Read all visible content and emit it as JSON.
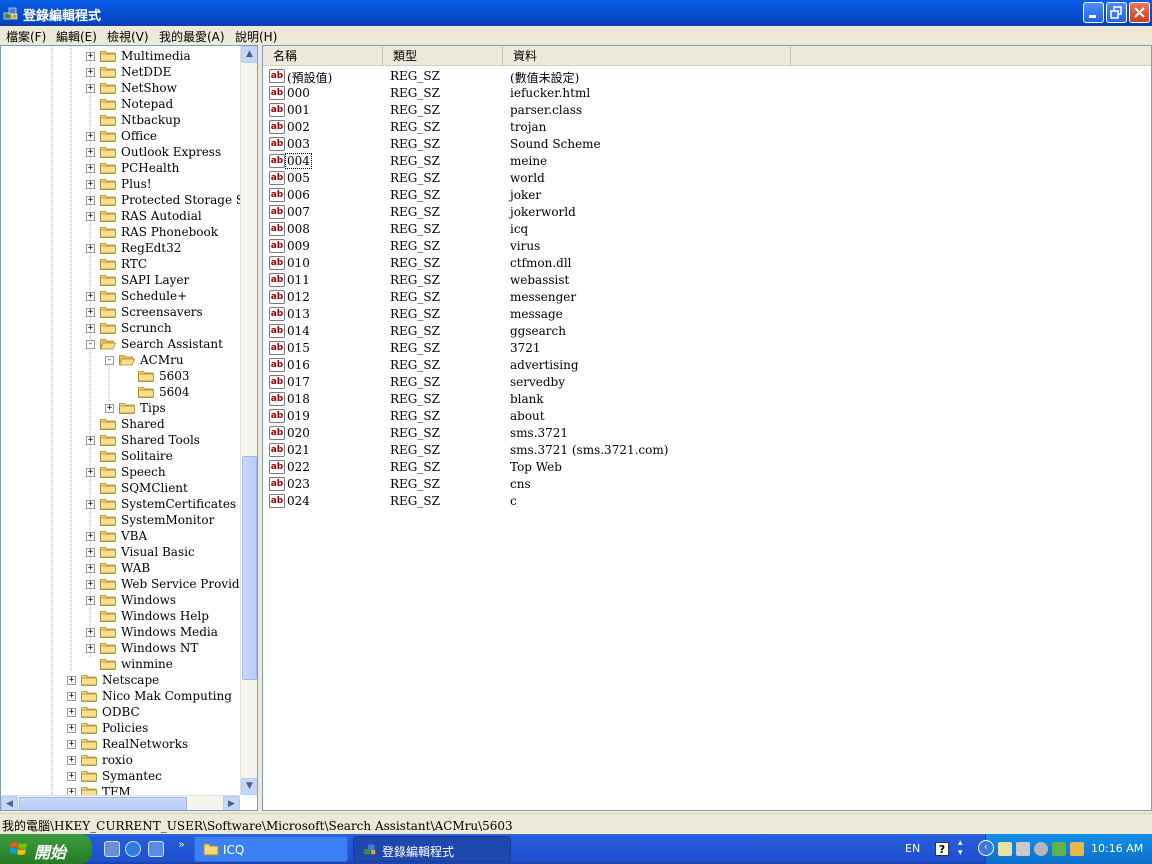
{
  "window": {
    "title": "登錄編輯程式"
  },
  "menu": [
    {
      "label": "檔案(F)"
    },
    {
      "label": "編輯(E)"
    },
    {
      "label": "檢視(V)"
    },
    {
      "label": "我的最愛(A)"
    },
    {
      "label": "說明(H)"
    }
  ],
  "tree": [
    {
      "label": "Multimedia",
      "level": 2,
      "expand": "+"
    },
    {
      "label": "NetDDE",
      "level": 2,
      "expand": "+"
    },
    {
      "label": "NetShow",
      "level": 2,
      "expand": "+"
    },
    {
      "label": "Notepad",
      "level": 2,
      "expand": ""
    },
    {
      "label": "Ntbackup",
      "level": 2,
      "expand": ""
    },
    {
      "label": "Office",
      "level": 2,
      "expand": "+"
    },
    {
      "label": "Outlook Express",
      "level": 2,
      "expand": "+"
    },
    {
      "label": "PCHealth",
      "level": 2,
      "expand": "+"
    },
    {
      "label": "Plus!",
      "level": 2,
      "expand": "+"
    },
    {
      "label": "Protected Storage System",
      "level": 2,
      "expand": "+"
    },
    {
      "label": "RAS Autodial",
      "level": 2,
      "expand": "+"
    },
    {
      "label": "RAS Phonebook",
      "level": 2,
      "expand": ""
    },
    {
      "label": "RegEdt32",
      "level": 2,
      "expand": "+"
    },
    {
      "label": "RTC",
      "level": 2,
      "expand": ""
    },
    {
      "label": "SAPI Layer",
      "level": 2,
      "expand": ""
    },
    {
      "label": "Schedule+",
      "level": 2,
      "expand": "+"
    },
    {
      "label": "Screensavers",
      "level": 2,
      "expand": "+"
    },
    {
      "label": "Scrunch",
      "level": 2,
      "expand": "+"
    },
    {
      "label": "Search Assistant",
      "level": 2,
      "expand": "-"
    },
    {
      "label": "ACMru",
      "level": 3,
      "expand": "-"
    },
    {
      "label": "5603",
      "level": 4,
      "expand": ""
    },
    {
      "label": "5604",
      "level": 4,
      "expand": ""
    },
    {
      "label": "Tips",
      "level": 3,
      "expand": "+"
    },
    {
      "label": "Shared",
      "level": 2,
      "expand": ""
    },
    {
      "label": "Shared Tools",
      "level": 2,
      "expand": "+"
    },
    {
      "label": "Solitaire",
      "level": 2,
      "expand": ""
    },
    {
      "label": "Speech",
      "level": 2,
      "expand": "+"
    },
    {
      "label": "SQMClient",
      "level": 2,
      "expand": ""
    },
    {
      "label": "SystemCertificates",
      "level": 2,
      "expand": "+"
    },
    {
      "label": "SystemMonitor",
      "level": 2,
      "expand": ""
    },
    {
      "label": "VBA",
      "level": 2,
      "expand": "+"
    },
    {
      "label": "Visual Basic",
      "level": 2,
      "expand": "+"
    },
    {
      "label": "WAB",
      "level": 2,
      "expand": "+"
    },
    {
      "label": "Web Service Providers",
      "level": 2,
      "expand": "+"
    },
    {
      "label": "Windows",
      "level": 2,
      "expand": "+"
    },
    {
      "label": "Windows Help",
      "level": 2,
      "expand": ""
    },
    {
      "label": "Windows Media",
      "level": 2,
      "expand": "+"
    },
    {
      "label": "Windows NT",
      "level": 2,
      "expand": "+"
    },
    {
      "label": "winmine",
      "level": 2,
      "expand": ""
    },
    {
      "label": "Netscape",
      "level": 1,
      "expand": "+"
    },
    {
      "label": "Nico Mak Computing",
      "level": 1,
      "expand": "+"
    },
    {
      "label": "ODBC",
      "level": 1,
      "expand": "+"
    },
    {
      "label": "Policies",
      "level": 1,
      "expand": "+"
    },
    {
      "label": "RealNetworks",
      "level": 1,
      "expand": "+"
    },
    {
      "label": "roxio",
      "level": 1,
      "expand": "+"
    },
    {
      "label": "Symantec",
      "level": 1,
      "expand": "+"
    },
    {
      "label": "TFM",
      "level": 1,
      "expand": "+"
    }
  ],
  "list": {
    "columns": [
      "名稱",
      "類型",
      "資料"
    ],
    "rows": [
      {
        "name": "(預設值)",
        "type": "REG_SZ",
        "data": "(數值未設定)"
      },
      {
        "name": "000",
        "type": "REG_SZ",
        "data": "iefucker.html"
      },
      {
        "name": "001",
        "type": "REG_SZ",
        "data": "parser.class"
      },
      {
        "name": "002",
        "type": "REG_SZ",
        "data": "trojan"
      },
      {
        "name": "003",
        "type": "REG_SZ",
        "data": "Sound Scheme"
      },
      {
        "name": "004",
        "type": "REG_SZ",
        "data": "meine"
      },
      {
        "name": "005",
        "type": "REG_SZ",
        "data": "world"
      },
      {
        "name": "006",
        "type": "REG_SZ",
        "data": "joker"
      },
      {
        "name": "007",
        "type": "REG_SZ",
        "data": "jokerworld"
      },
      {
        "name": "008",
        "type": "REG_SZ",
        "data": "icq"
      },
      {
        "name": "009",
        "type": "REG_SZ",
        "data": "virus"
      },
      {
        "name": "010",
        "type": "REG_SZ",
        "data": "ctfmon.dll"
      },
      {
        "name": "011",
        "type": "REG_SZ",
        "data": "webassist"
      },
      {
        "name": "012",
        "type": "REG_SZ",
        "data": "messenger"
      },
      {
        "name": "013",
        "type": "REG_SZ",
        "data": "message"
      },
      {
        "name": "014",
        "type": "REG_SZ",
        "data": "ggsearch"
      },
      {
        "name": "015",
        "type": "REG_SZ",
        "data": "3721"
      },
      {
        "name": "016",
        "type": "REG_SZ",
        "data": "advertising"
      },
      {
        "name": "017",
        "type": "REG_SZ",
        "data": "servedby"
      },
      {
        "name": "018",
        "type": "REG_SZ",
        "data": "blank"
      },
      {
        "name": "019",
        "type": "REG_SZ",
        "data": "about"
      },
      {
        "name": "020",
        "type": "REG_SZ",
        "data": "sms.3721"
      },
      {
        "name": "021",
        "type": "REG_SZ",
        "data": "sms.3721 (sms.3721.com)"
      },
      {
        "name": "022",
        "type": "REG_SZ",
        "data": "Top Web"
      },
      {
        "name": "023",
        "type": "REG_SZ",
        "data": "cns"
      },
      {
        "name": "024",
        "type": "REG_SZ",
        "data": "c"
      }
    ]
  },
  "status": {
    "path": "我的電腦\\HKEY_CURRENT_USER\\Software\\Microsoft\\Search Assistant\\ACMru\\5603"
  },
  "taskbar": {
    "start_label": "開始",
    "tasks": [
      {
        "label": "ICQ",
        "state": "inactive"
      },
      {
        "label": "登錄編輯程式",
        "state": "active"
      }
    ],
    "lang": "EN",
    "help": "?",
    "clock": "10:16 AM"
  },
  "colors": {
    "titlebar": "#0a5ee8",
    "value_icon_text": "#a10000",
    "taskbar": "#245edb",
    "start": "#2f8a2f"
  }
}
